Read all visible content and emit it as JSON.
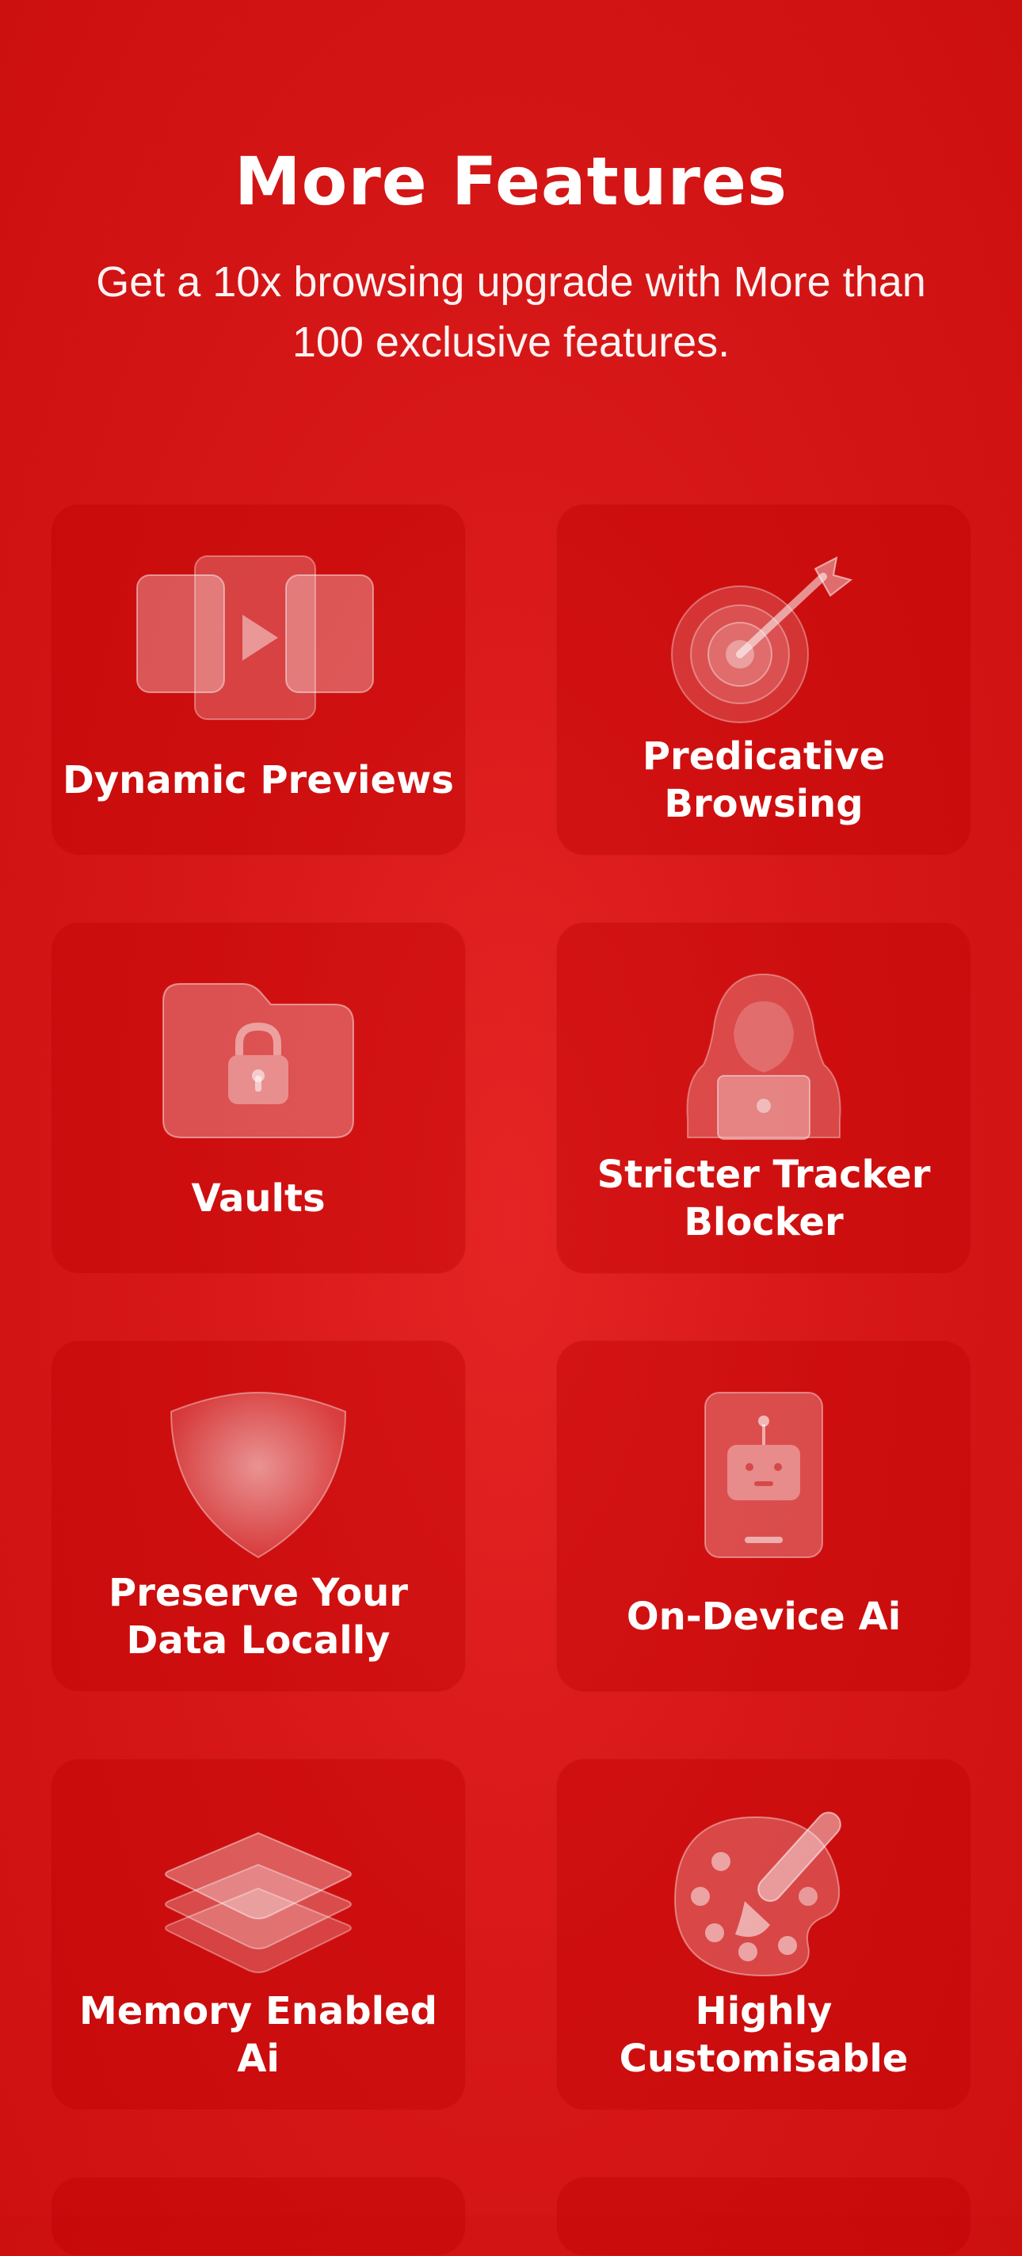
{
  "header": {
    "title": "More Features",
    "subtitle": "Get a 10x browsing upgrade with More than 100 exclusive features."
  },
  "features": [
    {
      "label": "Dynamic Previews",
      "icon": "video-cards-icon"
    },
    {
      "label": "Predicative Browsing",
      "icon": "target-icon"
    },
    {
      "label": "Vaults",
      "icon": "locked-folder-icon"
    },
    {
      "label": "Stricter Tracker Blocker",
      "icon": "hacker-icon"
    },
    {
      "label": "Preserve Your Data Locally",
      "icon": "shield-icon"
    },
    {
      "label": "On-Device Ai",
      "icon": "phone-robot-icon"
    },
    {
      "label": "Memory Enabled Ai",
      "icon": "layers-icon"
    },
    {
      "label": "Highly Customisable",
      "icon": "palette-icon"
    }
  ],
  "colors": {
    "background": "#d81818",
    "card": "#c40a0a",
    "text": "#ffffff"
  }
}
